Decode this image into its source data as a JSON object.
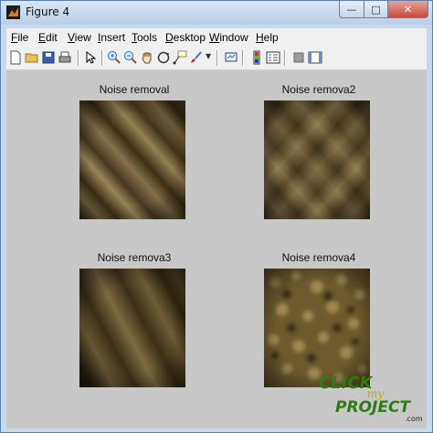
{
  "window": {
    "title": "Figure 4"
  },
  "menubar": {
    "items": [
      {
        "accel": "F",
        "rest": "ile"
      },
      {
        "accel": "E",
        "rest": "dit"
      },
      {
        "accel": "V",
        "rest": "iew"
      },
      {
        "accel": "I",
        "rest": "nsert"
      },
      {
        "accel": "T",
        "rest": "ools"
      },
      {
        "accel": "D",
        "rest": "esktop"
      },
      {
        "accel": "W",
        "rest": "indow"
      },
      {
        "accel": "H",
        "rest": "elp"
      }
    ]
  },
  "toolbar": {
    "icons": [
      "new-figure-icon",
      "open-file-icon",
      "save-icon",
      "print-icon",
      "edit-plot-arrow-icon",
      "zoom-in-icon",
      "zoom-out-icon",
      "pan-hand-icon",
      "rotate-3d-icon",
      "data-cursor-icon",
      "brush-icon",
      "link-plot-icon",
      "insert-colorbar-icon",
      "insert-legend-icon",
      "hide-plot-tools-icon",
      "show-plot-tools-icon"
    ]
  },
  "plots": [
    {
      "title": "Noise removal"
    },
    {
      "title": "Noise remova2"
    },
    {
      "title": "Noise remova3"
    },
    {
      "title": "Noise remova4"
    }
  ],
  "watermark": {
    "line1": "CLICK",
    "line2": "my",
    "line3": "PROJECT",
    "suffix": ".com"
  },
  "colors": {
    "image_base": "#5a4a2a",
    "canvas": "#c8c8c8",
    "title_bar": "#c9dbee"
  }
}
